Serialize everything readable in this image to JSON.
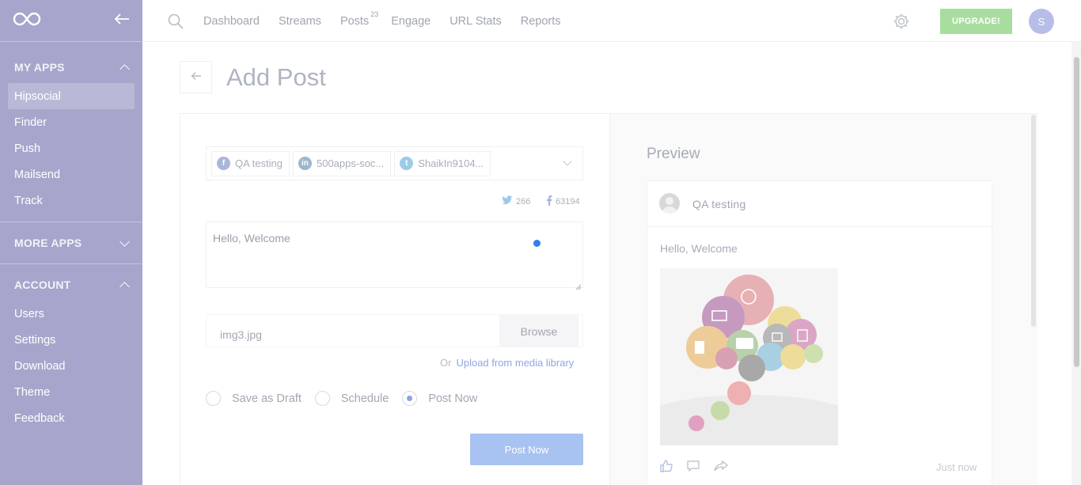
{
  "sidebar": {
    "logo_icon": "infinity-logo",
    "collapse_icon": "arrow-left-icon",
    "sections": [
      {
        "title": "MY APPS",
        "expanded": true,
        "items": [
          "Hipsocial",
          "Finder",
          "Push",
          "Mailsend",
          "Track"
        ],
        "active": "Hipsocial"
      },
      {
        "title": "MORE APPS",
        "expanded": false,
        "items": []
      },
      {
        "title": "ACCOUNT",
        "expanded": true,
        "items": [
          "Users",
          "Settings",
          "Download",
          "Theme",
          "Feedback"
        ]
      }
    ]
  },
  "topnav": {
    "links": [
      "Dashboard",
      "Streams",
      "Posts",
      "Engage",
      "URL Stats",
      "Reports"
    ],
    "posts_count": "23",
    "upgrade_label": "UPGRADE!",
    "avatar_initial": "S"
  },
  "page": {
    "title": "Add Post"
  },
  "composer": {
    "accounts": [
      {
        "network": "facebook",
        "icon_text": "f",
        "name": "QA testing"
      },
      {
        "network": "linkedin",
        "icon_text": "in",
        "name": "500apps-soc..."
      },
      {
        "network": "twitter",
        "icon_text": "t",
        "name": "ShaikIn9104..."
      }
    ],
    "twitter_count": "266",
    "facebook_count": "63194",
    "message": "Hello, Welcome",
    "file_name": "img3.jpg",
    "browse_label": "Browse",
    "or_label": "Or",
    "media_library_link": "Upload from media library",
    "options": [
      "Save as Draft",
      "Schedule",
      "Post Now"
    ],
    "selected_option": "Post Now",
    "submit_label": "Post Now"
  },
  "preview": {
    "title": "Preview",
    "account_name": "QA testing",
    "text": "Hello, Welcome",
    "timestamp": "Just now"
  },
  "colors": {
    "sidebar_bg": "#a6a6cc",
    "upgrade_bg": "#a9dda0",
    "primary_button": "#a8c2f2",
    "link": "#8fa6e0"
  }
}
